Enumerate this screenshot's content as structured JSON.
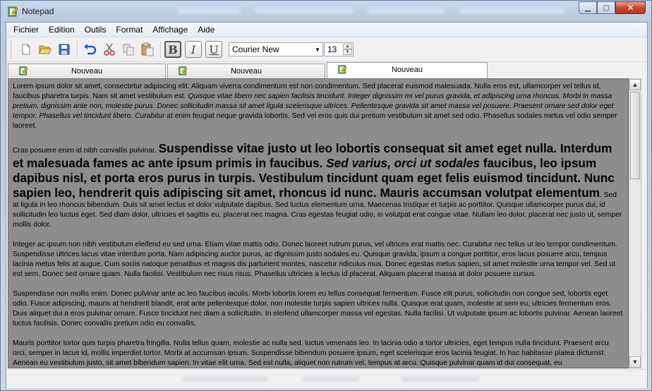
{
  "window": {
    "title": "Notepad",
    "accent": "#c6d6ea",
    "close_color": "#c9462c"
  },
  "menu": [
    "Fichier",
    "Edition",
    "Outils",
    "Format",
    "Affichage",
    "Aide"
  ],
  "toolbar": {
    "icons": [
      "new-file-icon",
      "open-folder-icon",
      "save-icon",
      "undo-icon",
      "cut-icon",
      "copy-icon",
      "paste-icon"
    ],
    "bold_label": "B",
    "italic_label": "I",
    "underline_label": "U",
    "font_value": "Courier New",
    "size_value": "13"
  },
  "tabs": [
    {
      "label": "Nouveau",
      "active": false
    },
    {
      "label": "Nouveau",
      "active": false
    },
    {
      "label": "Nouveau",
      "active": true
    }
  ],
  "document": {
    "p1_a": "Lorem ipsum dolor sit amet, consectetur adipiscing elit. Aliquam viverra condimentum est non condimentum. Sed placerat euismod malesuada. Nulla eros est, ullamcorper vel tellus id, faucibus pharetra turpis. Nam sit amet vestibulum est. ",
    "p1_b": "Quisque vitae libero nec sapien facilisis tincidunt. Integer dignissim mi vel purus gravida, et adipiscing urna rhoncus. Morbi in massa pretium, dignissim ante non, molestie purus. Donec sollicitudin massa sit amet ligula scelerisque ultrices. Pellentesque gravida sit amet massa vel posuere. Praesent ornare sed dolor eget tempor. Phasellus vel tincidunt libero. Curabitur",
    "p1_c": " at enim feugiat neque gravida lobortis. Sed vel eros quis dui pretium vestibulum sit amet sed odio. Phasellus sodales metus vel odio semper laoreet.",
    "p2_a": "Cras posuere enim id nibh convallis pulvinar. ",
    "p2_big1": "Suspendisse vitae justo ut leo lobortis consequat sit amet eget nulla. Interdum et malesuada fames ac ante ipsum primis in faucibus. ",
    "p2_big_italic": "Sed varius, orci ut sodales",
    "p2_big2": " faucibus, leo ipsum dapibus nisl, et porta eros purus in turpis. Vestibulum tincidunt quam eget felis euismod tincidunt. Nunc sapien leo, hendrerit quis adipiscing sit amet, rhoncus id nunc. Mauris accumsan volutpat elementum",
    "p2_b": ". Sed at ligula in leo rhoncus bibendum. Duis sit amet lectus et dolor vulputate dapibus. Sed luctus elementum urna. Maecenas tristique et turpis ac porttitor. Quisque ullamcorper purus dui, id sollicitudin leo luctus eget. Sed diam dolor, ultricies et sagittis eu, placerat nec magna. Cras egestas feugiat odio, in volutpat erat congue vitae. Nullam leo dolor, placerat nec justo ut, semper mollis dolor.",
    "p3": "Integer ac ipsum non nibh vestibulum eleifend eu sed urna. Etiam vitae mattis odio. Donec laoreet rutrum purus, vel ultrices erat mattis nec. Curabitur nec tellus ut leo tempor condimentum. Suspendisse ultrices lacus vitae interdum porta. Nam adipiscing auctor purus, ac dignissim justo sodales eu. Quisque gravida, ipsum a congue porttitor, eros lacus posuere arcu, tempus lacinia metus felis at augue. Cum sociis natoque penatibus et magnis dis parturient montes, nascetur ridiculus mus. Donec egestas metus sapien, sit amet molestie urna tempor vel. Sed ut est sem. Donec sed ornare quam. Nulla facilisi. Vestibulum nec risus risus. Phasellus ultricies a lectus id placerat. Aliquam placerat massa at dolor posuere cursus.",
    "p4": "Suspendisse non mollis enim. Donec pulvinar ante ac leo faucibus iaculis. Morbi lobortis lorem eu tellus consequat fermentum. Fusce elit purus, sollicitudin non congue sed, lobortis eget odio. Fusce adipiscing, mauris at hendrerit blandit, erat ante pellentesque dolor, non molestie turpis sapien ultrices nulla. Quisque erat quam, molestie at sem eu, ultricies fermentum eros. Duis aliquet dui a eros pulvinar ornare. Fusce tincidunt nec diam a sollicitudin. In eleifend ullamcorper massa vel egestas. Nulla facilisi. Ut vulputate ipsum ac lobortis pulvinar. Aenean laoreet luctus facilisis. Donec convallis pretium odio eu convallis.",
    "p5": "Mauris porttitor tortor quis turpis pharetra fringilla. Nulla tellus quam, molestie ac nulla sed, luctus venenatis leo. In lacinia odio a tortor ultricies, eget tempus nulla tincidunt. Praesent arcu orci, semper in lacus id, mollis imperdiet tortor. Morbi at accumsan ipsum. Suspendisse bibendum posuere ipsum, eget scelerisque eros lacinia feugiat. In hac habitasse platea dictumst. Aenean eu vestibulum justo, sit amet bibendum sapien. In vitae elit urna. Sed est nulla, aliquet non rutrum vel, tempus at arcu. Quisque pulvinar quam id dui consequat, eu"
  }
}
